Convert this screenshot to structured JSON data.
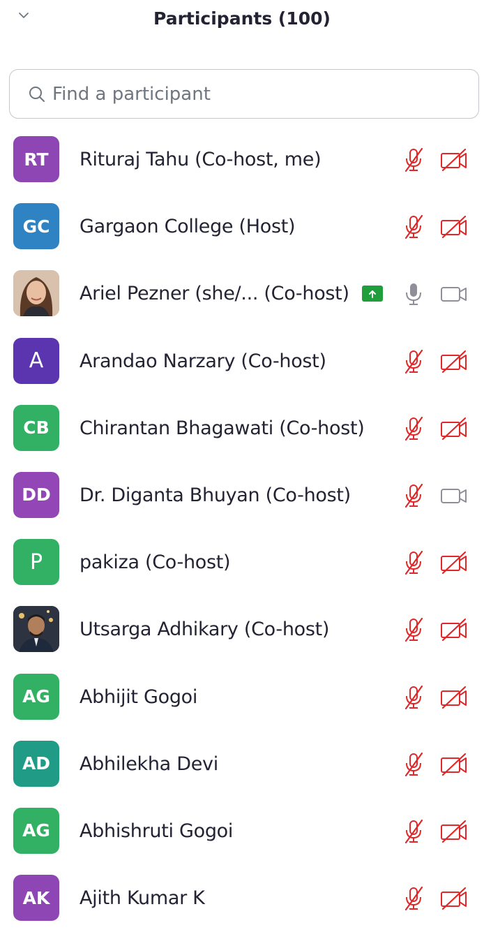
{
  "header": {
    "title": "Participants (100)",
    "collapse_icon": "chevron-down-icon"
  },
  "search": {
    "placeholder": "Find a participant",
    "value": "",
    "icon": "search-icon"
  },
  "colors": {
    "muted_red": "#e02828",
    "icon_gray": "#8f8f99",
    "share_green": "#1f9e3b"
  },
  "participants": [
    {
      "initials": "RT",
      "name": "Rituraj Tahu (Co-host, me)",
      "avatar_color": "#8d46b4",
      "mic": "muted",
      "video": "off"
    },
    {
      "initials": "GC",
      "name": "Gargaon College (Host)",
      "avatar_color": "#2f83c2",
      "mic": "muted",
      "video": "off"
    },
    {
      "initials": "",
      "name": "Ariel Pezner (she/... (Co-host)",
      "avatar_color": "#b47a58",
      "photo": "woman-portrait",
      "sharing": "share-screen-icon",
      "mic": "on",
      "video": "on"
    },
    {
      "initials": "A",
      "name": "Arandao Narzary (Co-host)",
      "avatar_color": "#5b35b0",
      "mic": "muted",
      "video": "off"
    },
    {
      "initials": "CB",
      "name": "Chirantan Bhagawati (Co-host)",
      "avatar_color": "#32b165",
      "mic": "muted",
      "video": "off"
    },
    {
      "initials": "DD",
      "name": "Dr. Diganta Bhuyan (Co-host)",
      "avatar_color": "#9346b6",
      "mic": "muted",
      "video": "on"
    },
    {
      "initials": "P",
      "name": "pakiza (Co-host)",
      "avatar_color": "#32b165",
      "mic": "muted",
      "video": "off"
    },
    {
      "initials": "",
      "name": "Utsarga Adhikary (Co-host)",
      "avatar_color": "#3a3f4a",
      "photo": "man-portrait",
      "mic": "muted",
      "video": "off"
    },
    {
      "initials": "AG",
      "name": "Abhijit Gogoi",
      "avatar_color": "#32b165",
      "mic": "muted",
      "video": "off"
    },
    {
      "initials": "AD",
      "name": "Abhilekha Devi",
      "avatar_color": "#1f9b86",
      "mic": "muted",
      "video": "off"
    },
    {
      "initials": "AG",
      "name": "Abhishruti Gogoi",
      "avatar_color": "#32b165",
      "mic": "muted",
      "video": "off"
    },
    {
      "initials": "AK",
      "name": "Ajith Kumar K",
      "avatar_color": "#8d46b4",
      "mic": "muted",
      "video": "off"
    }
  ]
}
